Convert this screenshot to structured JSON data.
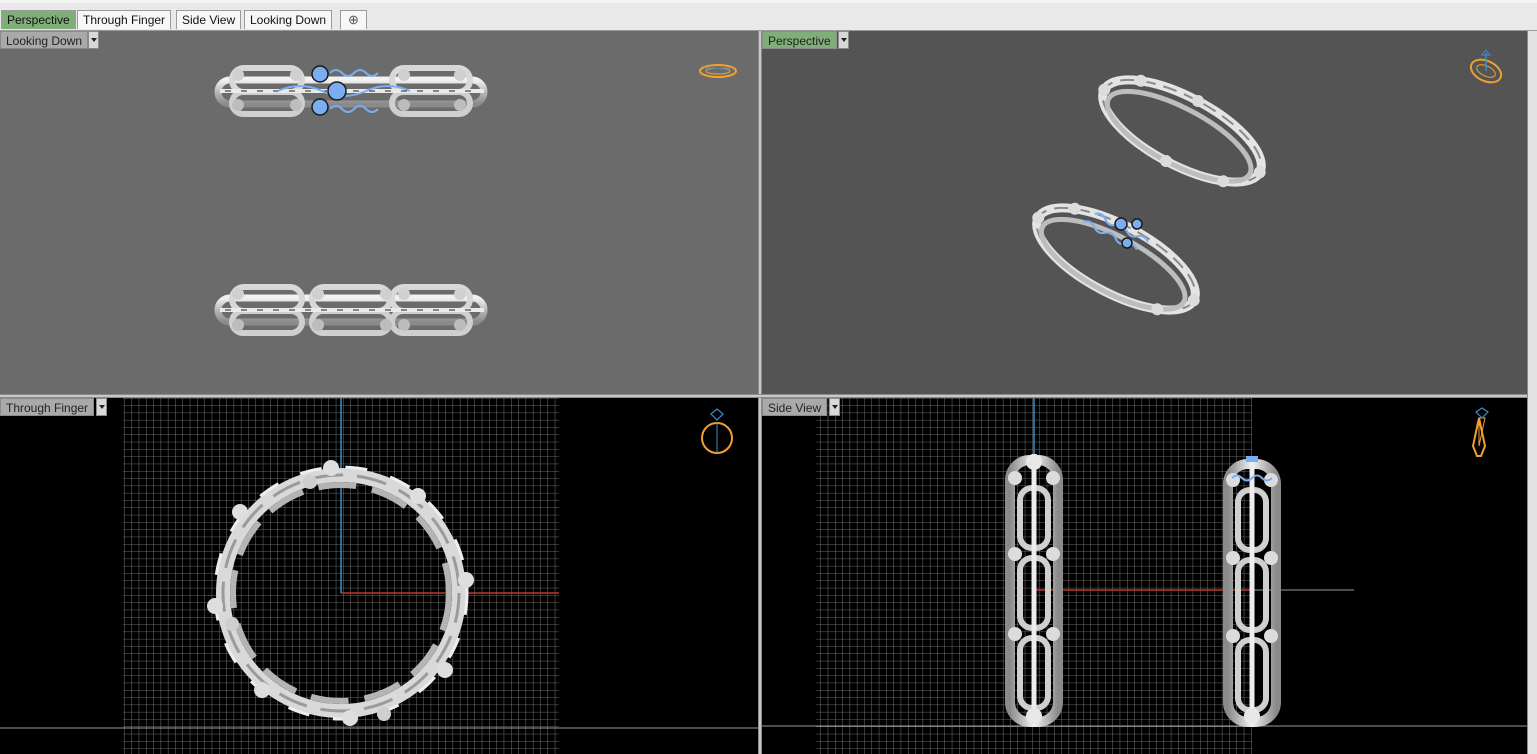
{
  "tabs": [
    {
      "label": "Perspective",
      "active": true
    },
    {
      "label": "Through Finger",
      "active": false
    },
    {
      "label": "Side View",
      "active": false
    },
    {
      "label": "Looking Down",
      "active": false
    }
  ],
  "add_tab_icon": "plus-icon",
  "viewports": {
    "top_left": {
      "label": "Looking Down",
      "background": "#6b6b6b"
    },
    "top_right": {
      "label": "Perspective",
      "background": "#545454"
    },
    "bottom_left": {
      "label": "Through Finger",
      "background": "#000000"
    },
    "bottom_right": {
      "label": "Side View",
      "background": "#000000"
    }
  },
  "colors": {
    "active_tab": "#7fae78",
    "selection": "#7aaef0",
    "orientation_icon": "#f0a030",
    "axis_x": "#c0392b",
    "axis_y": "#3b8ec9"
  },
  "icons": {
    "looking_down_orientation": "ring-orientation-icon",
    "perspective_orientation": "ring-orientation-icon",
    "through_finger_orientation": "ring-front-icon",
    "side_view_orientation": "ring-side-icon"
  }
}
